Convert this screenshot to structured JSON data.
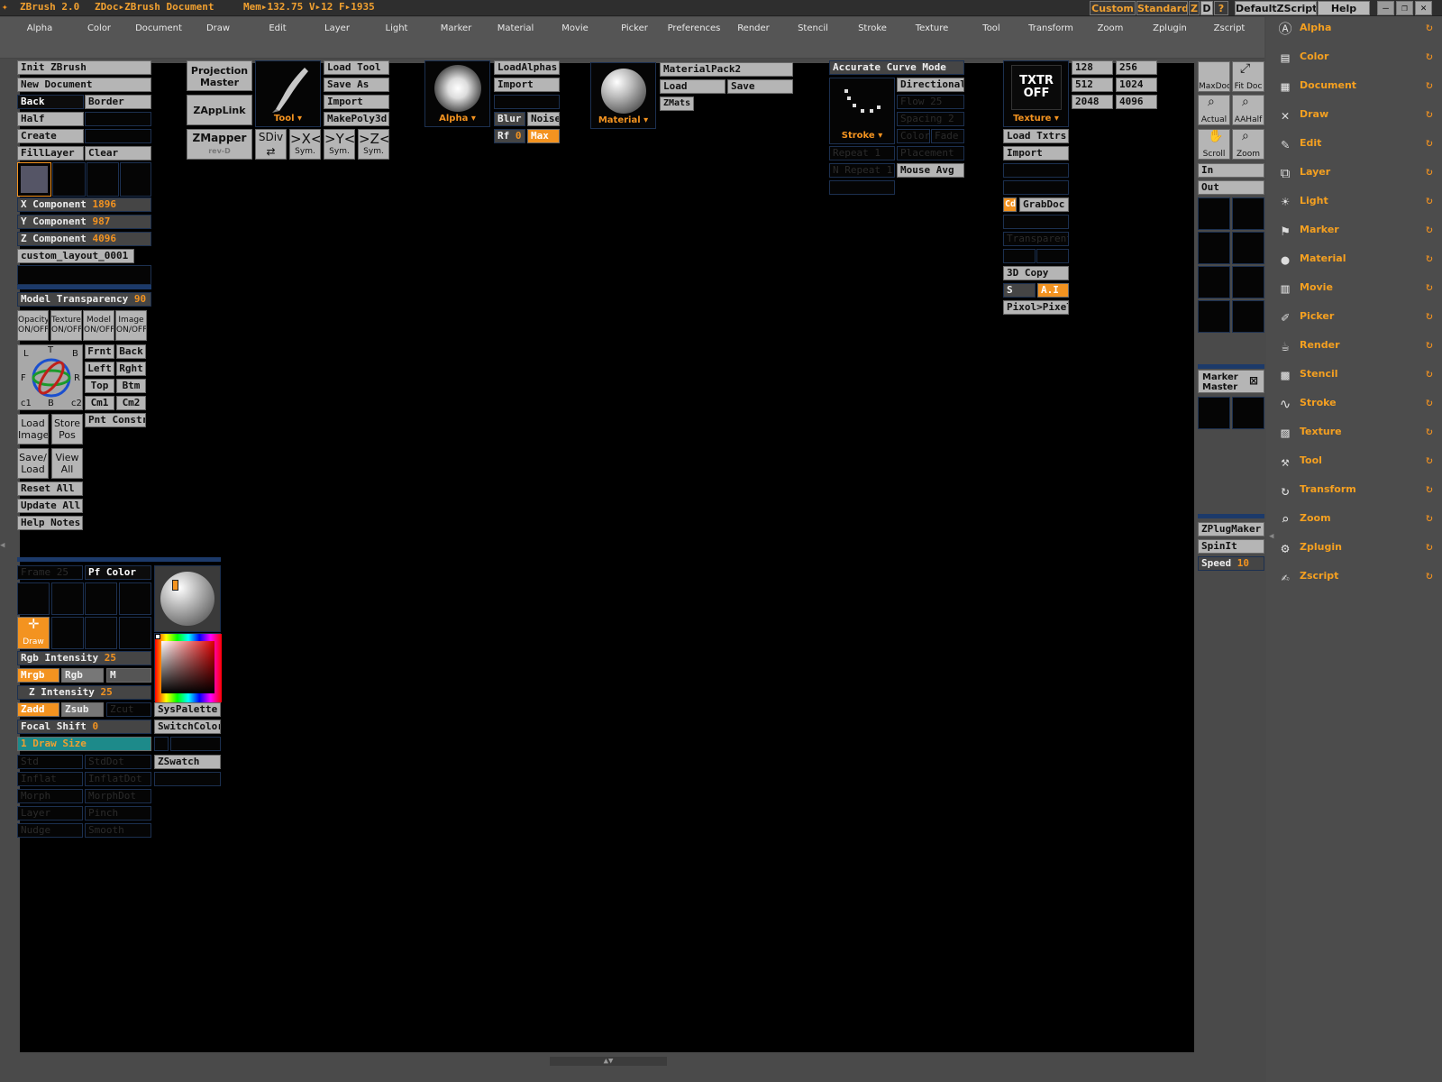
{
  "titlebar": {
    "app": "ZBrush 2.0",
    "doc": "ZDoc▸ZBrush Document",
    "mem": "Mem▸132.75 V▸12 F▸1935",
    "custom": "Custom",
    "standard": "Standard",
    "z": "Z",
    "d": "D",
    "q": "?",
    "script": "DefaultZScript",
    "help": "Help"
  },
  "menu": [
    "Alpha",
    "Color",
    "Document",
    "Draw",
    "Edit",
    "Layer",
    "Light",
    "Marker",
    "Material",
    "Movie",
    "Picker",
    "Preferences",
    "Render",
    "Stencil",
    "Stroke",
    "Texture",
    "Tool",
    "Transform",
    "Zoom",
    "Zplugin",
    "Zscript"
  ],
  "left": {
    "init": "Init ZBrush",
    "newdoc": "New Document",
    "back": "Back",
    "border": "Border",
    "half": "Half",
    "create": "Create",
    "filllayer": "FillLayer",
    "clear": "Clear",
    "xcomp_label": "X Component",
    "xcomp_val": "1896",
    "ycomp_label": "Y Component",
    "ycomp_val": "987",
    "zcomp_label": "Z Component",
    "zcomp_val": "4096",
    "layout_name": "custom_layout_0001",
    "transp_label": "Model Transparency",
    "transp_val": "90",
    "toggles": [
      [
        "Opacity",
        "ON/OFF"
      ],
      [
        "Texture",
        "ON/OFF"
      ],
      [
        "Model",
        "ON/OFF"
      ],
      [
        "Image",
        "ON/OFF"
      ]
    ],
    "gizmo_letters": {
      "l": "L",
      "t": "T",
      "b1": "B",
      "f": "F",
      "r": "R",
      "c1": "c1",
      "b2": "B",
      "c2": "c2"
    },
    "views": [
      "Frnt",
      "Back",
      "Left",
      "Rght",
      "Top",
      "Btm",
      "Cm1",
      "Cm2"
    ],
    "pnt": "Pnt Constr",
    "load_image": [
      "Load",
      "Image"
    ],
    "store_pos": [
      "Store",
      "Pos"
    ],
    "save_load": [
      "Save/",
      "Load"
    ],
    "view_all": [
      "View",
      "All"
    ],
    "reset": "Reset All",
    "update": "Update All",
    "help_notes": "Help Notes"
  },
  "toolbar": {
    "projection": [
      "Projection",
      "Master"
    ],
    "zapplink": "ZAppLink",
    "zmapper": "ZMapper",
    "zmapper_sub": "rev-D",
    "tool_label": "Tool",
    "load_tool": "Load Tool",
    "save_as": "Save As",
    "import": "Import",
    "makepoly": "MakePoly3d",
    "sdiv": "SDiv",
    "symx": ">X<",
    "symy": ">Y<",
    "symz": ">Z<",
    "sym": "Sym.",
    "alpha_label": "Alpha",
    "loadalphas": "LoadAlphas",
    "alpha_import": "Import",
    "blur": "Blur",
    "noise": "Noise",
    "rf": "Rf",
    "rf_val": "0",
    "max": "Max",
    "material_label": "Material",
    "materialpack": "MaterialPack2",
    "mat_load": "Load",
    "mat_save": "Save",
    "zmats": "ZMats",
    "curve_mode": "Accurate Curve Mode",
    "directional": "Directional",
    "stroke_label": "Stroke",
    "mouse_avg": "Mouse Avg",
    "stroke_ghosts": [
      "Flow 25",
      "Spacing 2",
      "Color",
      "Fade",
      "Repeat 1",
      "Placement",
      "N Repeat 1"
    ],
    "txtr": "TXTR",
    "off": "OFF",
    "texture_label": "Texture",
    "load_txtrs": "Load Txtrs",
    "tex_import": "Import",
    "cd": "Cd",
    "grabdoc": "GrabDoc",
    "transparent": "Transparent",
    "copy3d": "3D Copy",
    "s": "S",
    "ai": "A.I",
    "pixol": "Pixol>Pixel",
    "sizes": [
      "128",
      "256",
      "512",
      "1024",
      "2048",
      "4096"
    ]
  },
  "zoomcol": {
    "maxdoc": "MaxDoc",
    "fitdoc": "Fit Doc",
    "actual": "Actual",
    "aahalf": "AAHalf",
    "scroll": "Scroll",
    "zoom": "Zoom",
    "in": "In",
    "out": "Out",
    "marker_master": [
      "Marker",
      "Master"
    ],
    "zplugmaker": "ZPlugMaker",
    "spinit": "SpinIt",
    "speed_label": "Speed",
    "speed_val": "10"
  },
  "lower": {
    "frame": "Frame 25",
    "pfcolor": "Pf Color",
    "draw": "Draw",
    "rgb_int_label": "Rgb Intensity",
    "rgb_int_val": "25",
    "mrgb": "Mrgb",
    "rgb": "Rgb",
    "m": "M",
    "z_int_label": "Z Intensity",
    "z_int_val": "25",
    "zadd": "Zadd",
    "zsub": "Zsub",
    "zcut": "Zcut",
    "sys": "SysPalette",
    "switch": "SwitchColor",
    "focal_label": "Focal Shift",
    "focal_val": "0",
    "drawsize_label": "Draw Size",
    "drawsize_val": "1",
    "zswatch": "ZSwatch",
    "brush_ghosts": [
      "Std",
      "StdDot",
      "Inflat",
      "InflatDot",
      "Morph",
      "MorphDot",
      "Layer",
      "Pinch",
      "Nudge",
      "Smooth"
    ]
  },
  "right_panel": [
    {
      "label": "Alpha",
      "icon": "alpha-icon",
      "glyph": "Ⓐ"
    },
    {
      "label": "Color",
      "icon": "color-icon",
      "glyph": "▤"
    },
    {
      "label": "Document",
      "icon": "document-icon",
      "glyph": "▦"
    },
    {
      "label": "Draw",
      "icon": "draw-icon",
      "glyph": "✕"
    },
    {
      "label": "Edit",
      "icon": "edit-icon",
      "glyph": "✎"
    },
    {
      "label": "Layer",
      "icon": "layer-icon",
      "glyph": "⧉"
    },
    {
      "label": "Light",
      "icon": "light-icon",
      "glyph": "☀"
    },
    {
      "label": "Marker",
      "icon": "marker-icon",
      "glyph": "⚑"
    },
    {
      "label": "Material",
      "icon": "material-icon",
      "glyph": "●"
    },
    {
      "label": "Movie",
      "icon": "movie-icon",
      "glyph": "▥"
    },
    {
      "label": "Picker",
      "icon": "picker-icon",
      "glyph": "✐"
    },
    {
      "label": "Render",
      "icon": "render-icon",
      "glyph": "☕"
    },
    {
      "label": "Stencil",
      "icon": "stencil-icon",
      "glyph": "▩"
    },
    {
      "label": "Stroke",
      "icon": "stroke-icon",
      "glyph": "∿"
    },
    {
      "label": "Texture",
      "icon": "texture-icon",
      "glyph": "▨"
    },
    {
      "label": "Tool",
      "icon": "tool-icon",
      "glyph": "⚒"
    },
    {
      "label": "Transform",
      "icon": "transform-icon",
      "glyph": "↻"
    },
    {
      "label": "Zoom",
      "icon": "zoom-icon",
      "glyph": "⌕"
    },
    {
      "label": "Zplugin",
      "icon": "zplugin-icon",
      "glyph": "⚙"
    },
    {
      "label": "Zscript",
      "icon": "zscript-icon",
      "glyph": "✍"
    }
  ],
  "colors": {
    "accent": "#f39320",
    "canvas": "#000000",
    "panel": "#4a4a4a",
    "button": "#b5b5b5",
    "teal": "#1d8a8a"
  }
}
